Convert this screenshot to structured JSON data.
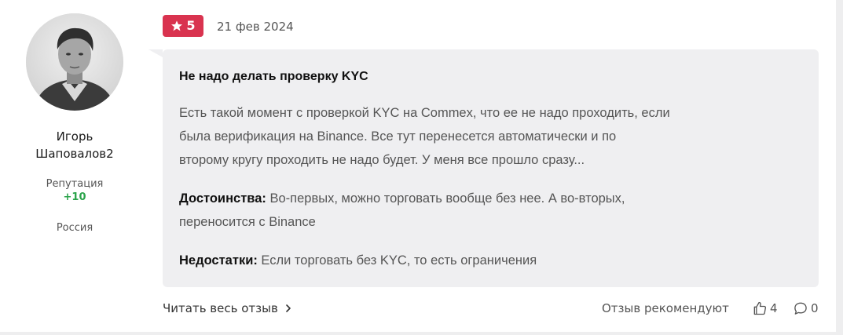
{
  "author": {
    "name_line1": "Игорь",
    "name_line2": "Шаповалов2",
    "reputation_label": "Репутация",
    "reputation_value": "+10",
    "country": "Россия"
  },
  "review": {
    "rating": "5",
    "date": "21 фев 2024",
    "title": "Не надо делать проверку KYC",
    "body_lines": [
      "Есть такой момент с проверкой KYC на Commex, что ее не надо проходить, если",
      "была верификация на Binance. Все тут перенесется автоматически и по",
      "второму кругу проходить не надо будет. У меня все прошло сразу..."
    ],
    "pros_label": "Достоинства:",
    "pros_lines": [
      " Во-первых, можно торговать вообще без нее. А во-вторых,",
      "переносится с Binance"
    ],
    "cons_label": "Недостатки:",
    "cons_text": " Если торговать без KYC, то есть ограничения"
  },
  "footer": {
    "read_more_label": "Читать весь отзыв",
    "recommend_label": "Отзыв рекомендуют",
    "likes_count": "4",
    "comments_count": "0"
  },
  "colors": {
    "rating_badge": "#d9334f",
    "reputation_positive": "#2aa34a",
    "card_background": "#efeff1"
  },
  "icons": {
    "rating": "star-icon",
    "read_more": "chevron-right-icon",
    "likes": "thumbs-up-icon",
    "comments": "comment-bubble-icon"
  }
}
